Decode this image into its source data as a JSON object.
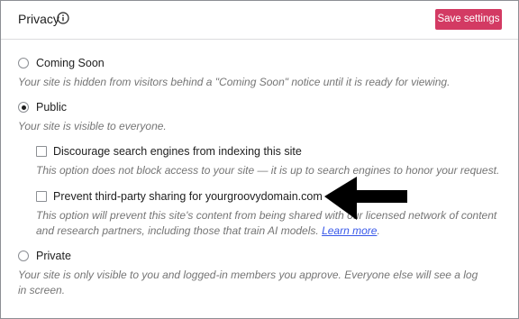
{
  "header": {
    "title": "Privacy",
    "info_icon": "info-icon",
    "save_label": "Save settings"
  },
  "options": {
    "coming_soon": {
      "label": "Coming Soon",
      "description": "Your site is hidden from visitors behind a \"Coming Soon\" notice until it is ready for viewing.",
      "selected": false
    },
    "public": {
      "label": "Public",
      "description": "Your site is visible to everyone.",
      "selected": true,
      "discourage": {
        "label": "Discourage search engines from indexing this site",
        "description": "This option does not block access to your site — it is up to search engines to honor your request.",
        "checked": false
      },
      "prevent_sharing": {
        "label": "Prevent third-party sharing for yourgroovydomain.com",
        "description_line1": "This option will prevent this site's content from being shared with our licensed network of content",
        "description_line2": "and research partners, including those that train AI models.",
        "learn_more": "Learn more",
        "description_end": ".",
        "checked": false
      }
    },
    "private": {
      "label": "Private",
      "description_line1": "Your site is only visible to you and logged-in members you approve. Everyone else will see a log",
      "description_line2": "in screen.",
      "selected": false
    }
  },
  "annotation": {
    "arrow_icon": "arrow-left-icon"
  },
  "colors": {
    "accent": "#d33a63",
    "link": "#3858e9",
    "muted_text": "#757575",
    "text": "#1e1e1e"
  }
}
